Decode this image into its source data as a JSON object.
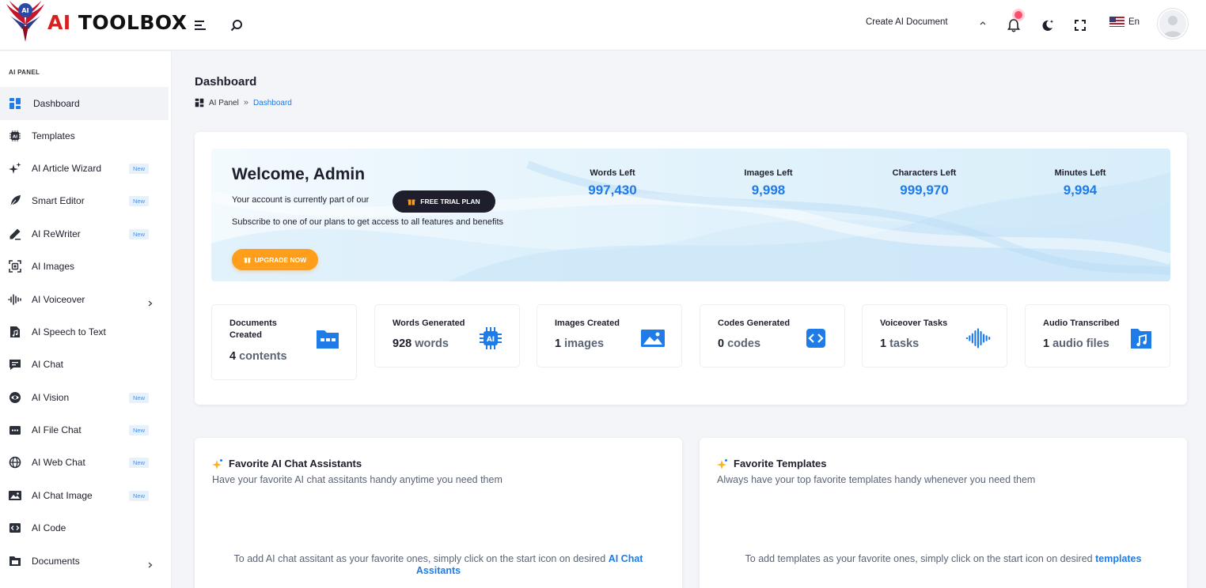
{
  "brand": {
    "name_prefix": "AI",
    "name_rest": " TOOLBOX"
  },
  "topbar": {
    "create_document": "Create AI Document",
    "language": "En"
  },
  "sidebar": {
    "section": "AI PANEL",
    "items": [
      {
        "label": "Dashboard",
        "icon": "dashboard-icon"
      },
      {
        "label": "Templates",
        "icon": "ai-chip-icon"
      },
      {
        "label": "AI Article Wizard",
        "icon": "sparkles-icon",
        "badge": "New"
      },
      {
        "label": "Smart Editor",
        "icon": "feather-icon",
        "badge": "New"
      },
      {
        "label": "AI ReWriter",
        "icon": "pen-icon",
        "badge": "New"
      },
      {
        "label": "AI Images",
        "icon": "image-scan-icon"
      },
      {
        "label": "AI Voiceover",
        "icon": "waveform-icon",
        "has_submenu": true
      },
      {
        "label": "AI Speech to Text",
        "icon": "music-file-icon"
      },
      {
        "label": "AI Chat",
        "icon": "chat-icon"
      },
      {
        "label": "AI Vision",
        "icon": "vision-icon",
        "badge": "New"
      },
      {
        "label": "AI File Chat",
        "icon": "file-chat-icon",
        "badge": "New"
      },
      {
        "label": "AI Web Chat",
        "icon": "globe-icon",
        "badge": "New"
      },
      {
        "label": "AI Chat Image",
        "icon": "image-icon",
        "badge": "New"
      },
      {
        "label": "AI Code",
        "icon": "code-icon"
      },
      {
        "label": "Documents",
        "icon": "folder-icon",
        "has_submenu": true
      }
    ]
  },
  "page": {
    "title": "Dashboard",
    "breadcrumb": {
      "root": "AI Panel",
      "separator": "»",
      "current": "Dashboard"
    }
  },
  "welcome": {
    "title": "Welcome, Admin",
    "account_text": "Your account is currently part of our",
    "plan_label": "FREE TRIAL PLAN",
    "description": "Subscribe to one of our plans to get access to all features and benefits",
    "upgrade_label": "UPGRADE NOW"
  },
  "balances": [
    {
      "label": "Words Left",
      "value": "997,430"
    },
    {
      "label": "Images Left",
      "value": "9,998"
    },
    {
      "label": "Characters Left",
      "value": "999,970"
    },
    {
      "label": "Minutes Left",
      "value": "9,994"
    }
  ],
  "stats": [
    {
      "title": "Documents Created",
      "count": "4",
      "unit": "contents",
      "icon": "documents-icon"
    },
    {
      "title": "Words Generated",
      "count": "928",
      "unit": "words",
      "icon": "ai-chip-icon"
    },
    {
      "title": "Images Created",
      "count": "1",
      "unit": "images",
      "icon": "image-icon"
    },
    {
      "title": "Codes Generated",
      "count": "0",
      "unit": "codes",
      "icon": "code-icon"
    },
    {
      "title": "Voiceover Tasks",
      "count": "1",
      "unit": "tasks",
      "icon": "waveform-icon"
    },
    {
      "title": "Audio Transcribed",
      "count": "1",
      "unit": "audio files",
      "icon": "music-folder-icon"
    }
  ],
  "favorites": {
    "assistants": {
      "title": "Favorite AI Chat Assistants",
      "subtitle": "Have your favorite AI chat assitants handy anytime you need them",
      "empty_text": "To add AI chat assitant as your favorite ones, simply click on the start icon on desired",
      "empty_link": "AI Chat Assitants"
    },
    "templates": {
      "title": "Favorite Templates",
      "subtitle": "Always have your top favorite templates handy whenever you need them",
      "empty_text": "To add templates as your favorite ones, simply click on the start icon on desired",
      "empty_link": "templates"
    }
  },
  "colors": {
    "accent": "#1e7be8",
    "upgrade": "#ff9e1b",
    "dark": "#1e1e2d",
    "notification": "#ff4d6d",
    "logo_red": "#d61f1f"
  }
}
